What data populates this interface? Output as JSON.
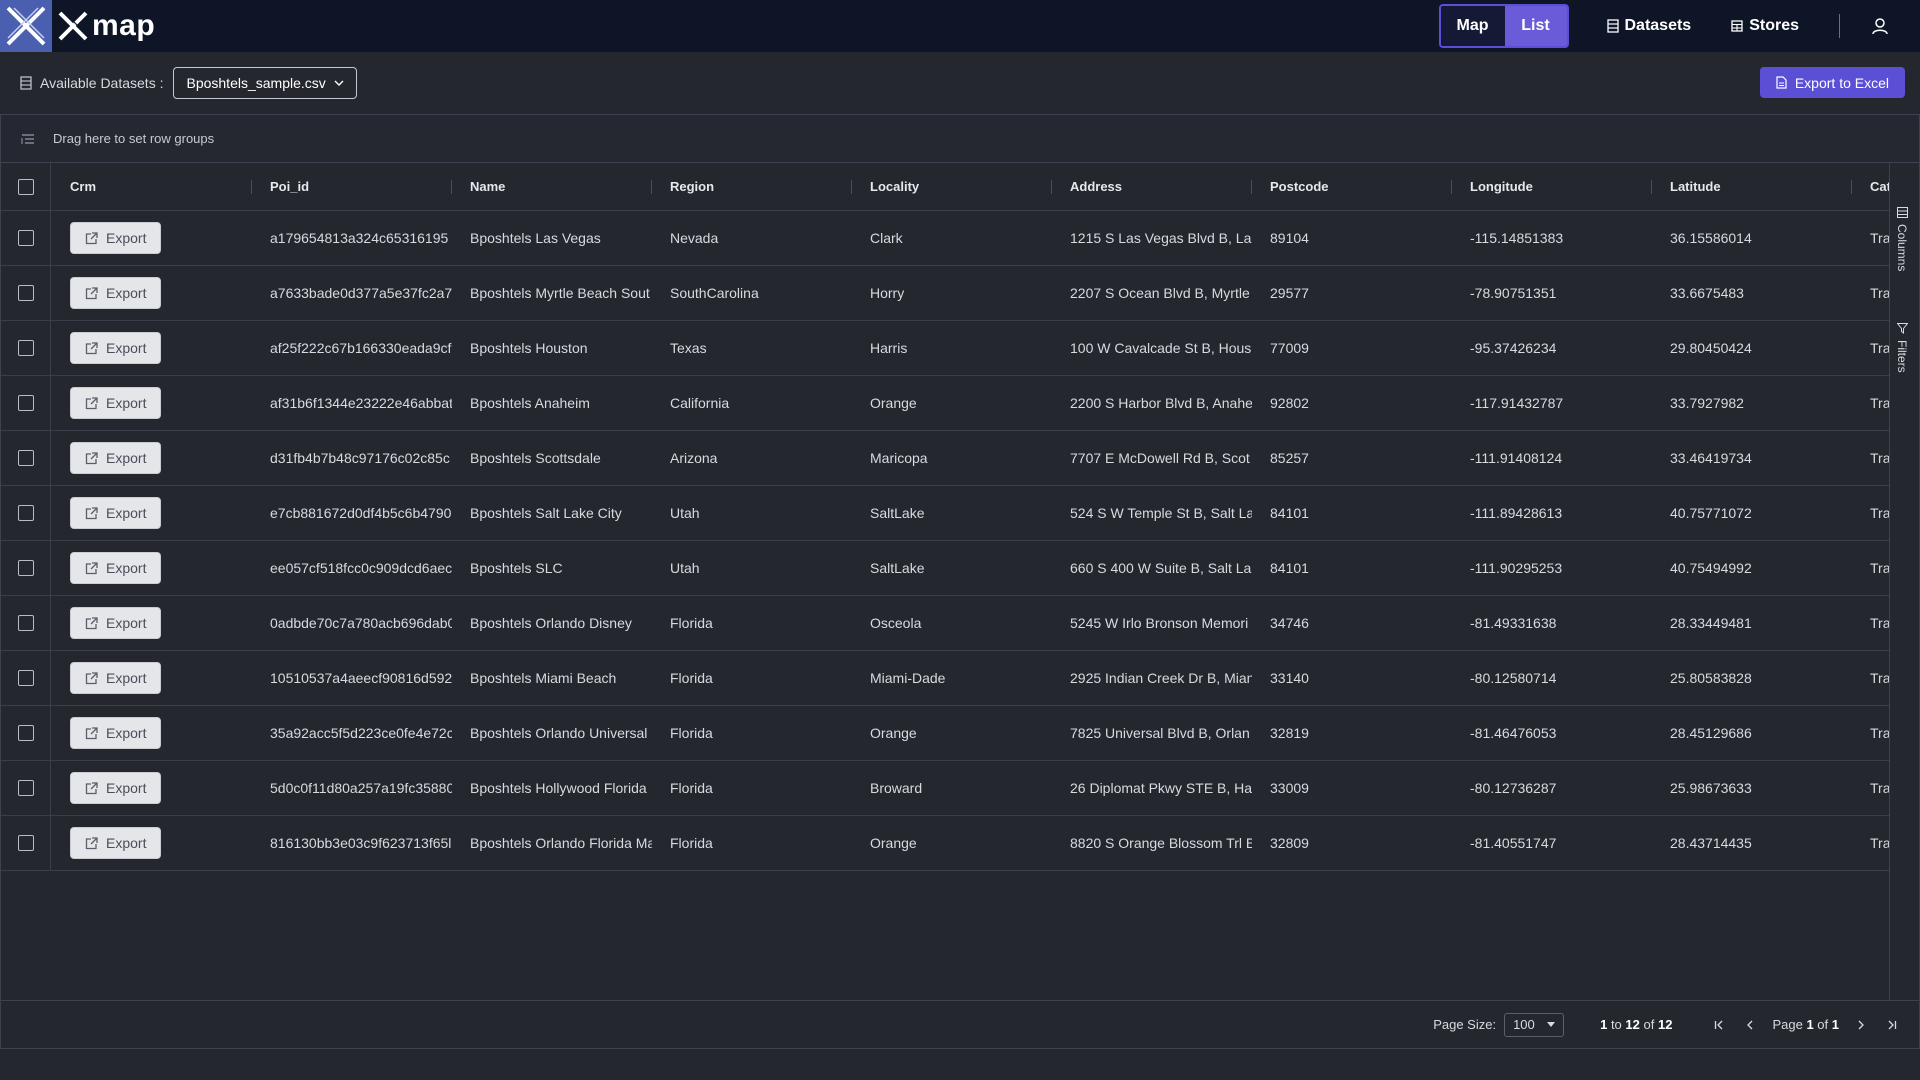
{
  "app": {
    "logo_text": "map"
  },
  "nav": {
    "toggle": {
      "map_label": "Map",
      "list_label": "List",
      "active": "List"
    },
    "datasets_label": "Datasets",
    "stores_label": "Stores"
  },
  "toolbar": {
    "available_label": "Available Datasets :",
    "selected_dataset": "Bposhtels_sample.csv",
    "export_excel_label": "Export to Excel"
  },
  "grid": {
    "group_hint": "Drag here to set row groups",
    "side_tabs": {
      "columns": "Columns",
      "filters": "Filters"
    },
    "columns": [
      "Crm",
      "Poi_id",
      "Name",
      "Region",
      "Locality",
      "Address",
      "Postcode",
      "Longitude",
      "Latitude",
      "Cat"
    ],
    "export_button_label": "Export",
    "rows": [
      {
        "poi_id": "a179654813a324c65316195",
        "name": "Bposhtels Las Vegas",
        "region": "Nevada",
        "locality": "Clark",
        "address": "1215 S Las Vegas Blvd B, La",
        "postcode": "89104",
        "longitude": "-115.14851383",
        "latitude": "36.15586014",
        "cat": "Tra"
      },
      {
        "poi_id": "a7633bade0d377a5e37fc2a7",
        "name": "Bposhtels Myrtle Beach Sout",
        "region": "SouthCarolina",
        "locality": "Horry",
        "address": "2207 S Ocean Blvd B, Myrtle",
        "postcode": "29577",
        "longitude": "-78.90751351",
        "latitude": "33.6675483",
        "cat": "Tra"
      },
      {
        "poi_id": "af25f222c67b166330eada9cf",
        "name": "Bposhtels Houston",
        "region": "Texas",
        "locality": "Harris",
        "address": "100 W Cavalcade St B, Hous",
        "postcode": "77009",
        "longitude": "-95.37426234",
        "latitude": "29.80450424",
        "cat": "Tra"
      },
      {
        "poi_id": "af31b6f1344e23222e46abbat",
        "name": "Bposhtels Anaheim",
        "region": "California",
        "locality": "Orange",
        "address": "2200 S Harbor Blvd B, Anahe",
        "postcode": "92802",
        "longitude": "-117.91432787",
        "latitude": "33.7927982",
        "cat": "Tra"
      },
      {
        "poi_id": "d31fb4b7b48c97176c02c85c",
        "name": "Bposhtels Scottsdale",
        "region": "Arizona",
        "locality": "Maricopa",
        "address": "7707 E McDowell Rd B, Scot",
        "postcode": "85257",
        "longitude": "-111.91408124",
        "latitude": "33.46419734",
        "cat": "Tra"
      },
      {
        "poi_id": "e7cb881672d0df4b5c6b4790",
        "name": "Bposhtels Salt Lake City",
        "region": "Utah",
        "locality": "SaltLake",
        "address": "524 S W Temple St B, Salt La",
        "postcode": "84101",
        "longitude": "-111.89428613",
        "latitude": "40.75771072",
        "cat": "Tra"
      },
      {
        "poi_id": "ee057cf518fcc0c909dcd6aec",
        "name": "Bposhtels SLC",
        "region": "Utah",
        "locality": "SaltLake",
        "address": "660 S 400 W Suite B, Salt La",
        "postcode": "84101",
        "longitude": "-111.90295253",
        "latitude": "40.75494992",
        "cat": "Tra"
      },
      {
        "poi_id": "0adbde70c7a780acb696dab0",
        "name": "Bposhtels Orlando Disney",
        "region": "Florida",
        "locality": "Osceola",
        "address": "5245 W Irlo Bronson Memori",
        "postcode": "34746",
        "longitude": "-81.49331638",
        "latitude": "28.33449481",
        "cat": "Tra"
      },
      {
        "poi_id": "10510537a4aeecf90816d592",
        "name": "Bposhtels Miami Beach",
        "region": "Florida",
        "locality": "Miami-Dade",
        "address": "2925 Indian Creek Dr B, Mian",
        "postcode": "33140",
        "longitude": "-80.12580714",
        "latitude": "25.80583828",
        "cat": "Tra"
      },
      {
        "poi_id": "35a92acc5f5d223ce0fe4e72c",
        "name": "Bposhtels Orlando Universal",
        "region": "Florida",
        "locality": "Orange",
        "address": "7825 Universal Blvd B, Orlan",
        "postcode": "32819",
        "longitude": "-81.46476053",
        "latitude": "28.45129686",
        "cat": "Tra"
      },
      {
        "poi_id": "5d0c0f11d80a257a19fc35880",
        "name": "Bposhtels Hollywood Florida",
        "region": "Florida",
        "locality": "Broward",
        "address": "26 Diplomat Pkwy STE B, Ha",
        "postcode": "33009",
        "longitude": "-80.12736287",
        "latitude": "25.98673633",
        "cat": "Tra"
      },
      {
        "poi_id": "816130bb3e03c9f623713f65l",
        "name": "Bposhtels Orlando Florida Ma",
        "region": "Florida",
        "locality": "Orange",
        "address": "8820 S Orange Blossom Trl E",
        "postcode": "32809",
        "longitude": "-81.40551747",
        "latitude": "28.43714435",
        "cat": "Tra"
      }
    ]
  },
  "pagination": {
    "page_size_label": "Page Size:",
    "page_size": "100",
    "range_from": "1",
    "range_to_word": "to",
    "range_to": "12",
    "of_word": "of",
    "total": "12",
    "page_word": "Page",
    "current_page": "1",
    "total_pages": "1"
  },
  "colors": {
    "topbar": "#0d1527",
    "accent": "#5b4fd6",
    "list_active": "#6a5cd8",
    "background": "#25272f"
  },
  "icons": [
    "logo-x-icon",
    "datasets-icon",
    "stores-icon",
    "user-icon",
    "dataset-icon",
    "chevron-down-icon",
    "export-file-icon",
    "row-group-icon",
    "export-external-icon",
    "columns-icon",
    "filters-icon",
    "first-page-icon",
    "prev-page-icon",
    "next-page-icon",
    "last-page-icon"
  ]
}
